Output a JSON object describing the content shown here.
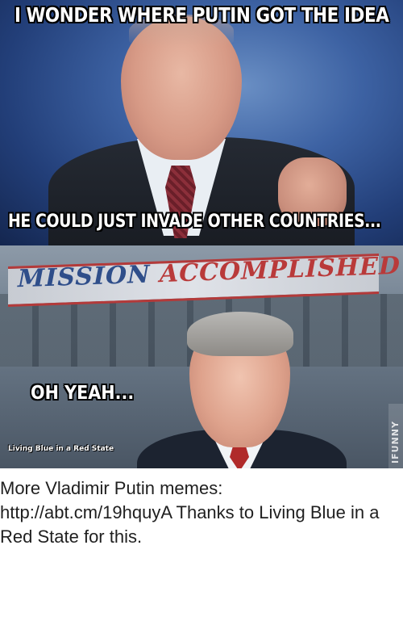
{
  "meme": {
    "top_caption": "I WONDER WHERE PUTIN GOT THE IDEA",
    "middle_caption": "HE COULD JUST INVADE OTHER COUNTRIES...",
    "banner_words": [
      "MISSION",
      "ACCOMPLISHED"
    ],
    "bottom_caption": "OH YEAH...",
    "credit": "Living Blue in a Red State",
    "watermark": "IFUNNY"
  },
  "description": "More Vladimir Putin memes: http://abt.cm/19hquyA Thanks to Living Blue in a Red State for this.",
  "colors": {
    "caption_text": "#ffffff",
    "caption_outline": "#000000",
    "banner_blue": "#2f4e8a",
    "banner_red": "#b93a3a",
    "description_text": "#1f1f1f"
  }
}
